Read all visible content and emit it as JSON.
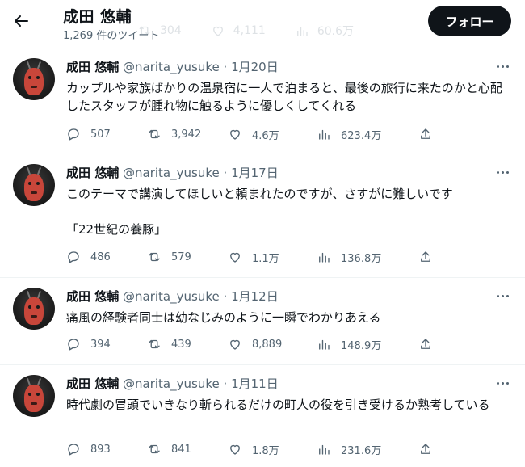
{
  "header": {
    "title": "成田 悠輔",
    "subtitle": "1,269 件のツイート",
    "follow_label": "フォロー",
    "ghost_counts": {
      "retweets": "304",
      "likes": "4,111",
      "views": "60.6万"
    }
  },
  "tweets": [
    {
      "name": "成田 悠輔",
      "handle": "@narita_yusuke",
      "dot": "·",
      "date": "1月20日",
      "text": "カップルや家族ばかりの温泉宿に一人で泊まると、最後の旅行に来たのかと心配したスタッフが腫れ物に触るように優しくしてくれる",
      "replies": "507",
      "retweets": "3,942",
      "likes": "4.6万",
      "views": "623.4万"
    },
    {
      "name": "成田 悠輔",
      "handle": "@narita_yusuke",
      "dot": "·",
      "date": "1月17日",
      "text": "このテーマで講演してほしいと頼まれたのですが、さすがに難しいです\n\n「22世紀の養豚」",
      "replies": "486",
      "retweets": "579",
      "likes": "1.1万",
      "views": "136.8万"
    },
    {
      "name": "成田 悠輔",
      "handle": "@narita_yusuke",
      "dot": "·",
      "date": "1月12日",
      "text": "痛風の経験者同士は幼なじみのように一瞬でわかりあえる",
      "replies": "394",
      "retweets": "439",
      "likes": "8,889",
      "views": "148.9万"
    },
    {
      "name": "成田 悠輔",
      "handle": "@narita_yusuke",
      "dot": "·",
      "date": "1月11日",
      "text": "時代劇の冒頭でいきなり斬られるだけの町人の役を引き受けるか熟考している",
      "replies": "893",
      "retweets": "841",
      "likes": "1.8万",
      "views": "231.6万"
    }
  ],
  "icons": {
    "back": "arrow-left-icon",
    "more": "more-horizontal-icon",
    "reply": "reply-bubble-icon",
    "retweet": "retweet-icon",
    "like": "heart-icon",
    "views": "views-bar-chart-icon",
    "share": "share-upload-icon"
  },
  "colors": {
    "primary_text": "#0f1419",
    "secondary_text": "#536471",
    "button_bg": "#0f1419",
    "divider": "#eff3f4"
  }
}
